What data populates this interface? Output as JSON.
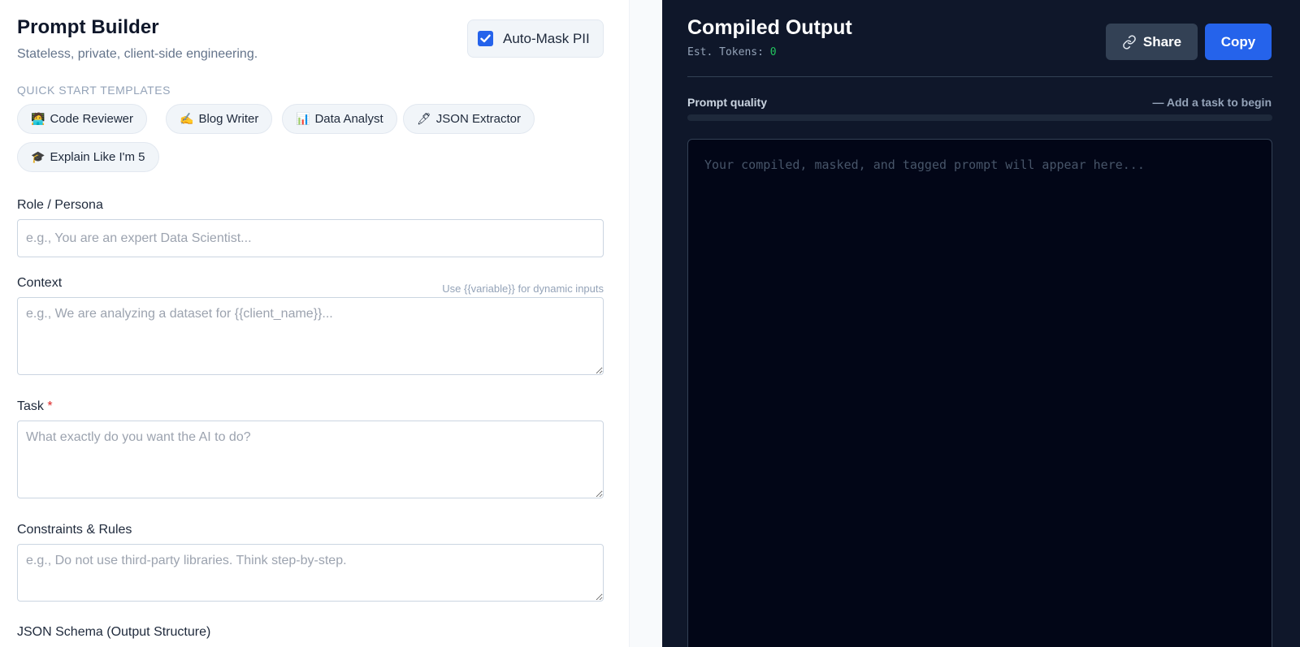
{
  "builder": {
    "title": "Prompt Builder",
    "subtitle": "Stateless, private, client-side engineering.",
    "auto_mask": {
      "label": "Auto-Mask PII",
      "checked": true
    }
  },
  "templates": {
    "section_label": "QUICK START TEMPLATES",
    "items": [
      {
        "emoji": "🧑‍💻",
        "label": "Code Reviewer"
      },
      {
        "emoji": "✍️",
        "label": "Blog Writer"
      },
      {
        "emoji": "📊",
        "label": "Data Analyst"
      },
      {
        "emoji": "🖊",
        "label": "JSON Extractor"
      },
      {
        "emoji": "🎓",
        "label": "Explain Like I'm 5"
      }
    ]
  },
  "fields": {
    "role": {
      "label": "Role / Persona",
      "placeholder": "e.g., You are an expert Data Scientist...",
      "value": ""
    },
    "context": {
      "label": "Context",
      "hint": "Use {{variable}} for dynamic inputs",
      "placeholder": "e.g., We are analyzing a dataset for {{client_name}}...",
      "value": ""
    },
    "task": {
      "label": "Task",
      "required_mark": "*",
      "placeholder": "What exactly do you want the AI to do?",
      "value": ""
    },
    "constraints": {
      "label": "Constraints & Rules",
      "placeholder": "e.g., Do not use third-party libraries. Think step-by-step.",
      "value": ""
    },
    "json_schema": {
      "label": "JSON Schema (Output Structure)"
    }
  },
  "output": {
    "title": "Compiled Output",
    "tokens_label": "Est. Tokens:",
    "tokens_value": "0",
    "share_label": "Share",
    "copy_label": "Copy",
    "quality_label": "Prompt quality",
    "quality_status": "— Add a task to begin",
    "quality_percent": 0,
    "placeholder": "Your compiled, masked, and tagged prompt will appear here..."
  },
  "colors": {
    "accent": "#2563eb",
    "dark_panel": "#0f172a",
    "token_green": "#22c55e",
    "required_red": "#dc2626"
  },
  "icons": {
    "checkbox": "check-icon",
    "share": "link-icon"
  }
}
